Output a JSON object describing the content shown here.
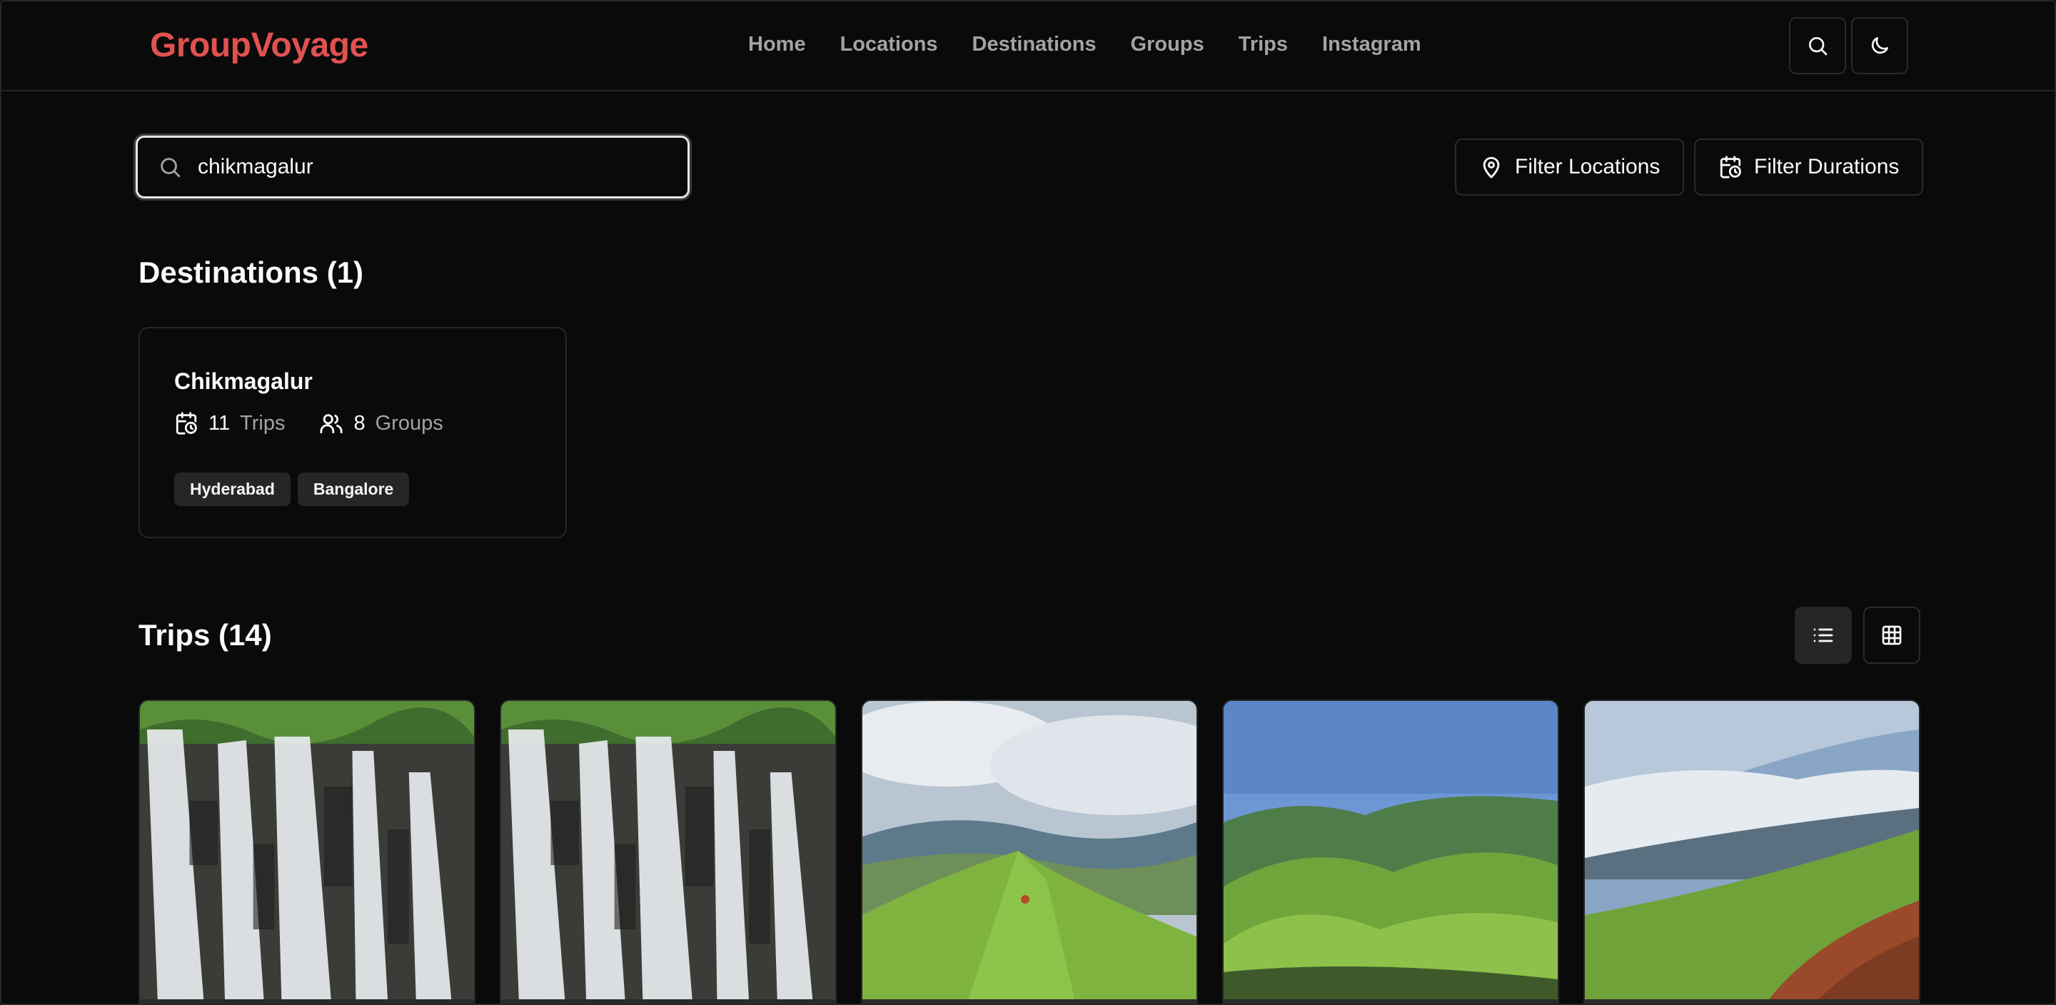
{
  "header": {
    "brand": "GroupVoyage",
    "nav": [
      "Home",
      "Locations",
      "Destinations",
      "Groups",
      "Trips",
      "Instagram"
    ]
  },
  "search": {
    "value": "chikmagalur"
  },
  "filters": {
    "locations": "Filter Locations",
    "durations": "Filter Durations"
  },
  "destinations": {
    "title": "Destinations (1)",
    "items": [
      {
        "name": "Chikmagalur",
        "trips_count": "11",
        "trips_label": "Trips",
        "groups_count": "8",
        "groups_label": "Groups",
        "tags": [
          "Hyderabad",
          "Bangalore"
        ]
      }
    ]
  },
  "trips": {
    "title": "Trips (14)",
    "cards": [
      {
        "image": "waterfall"
      },
      {
        "image": "waterfall"
      },
      {
        "image": "green-ridge-with-hiker"
      },
      {
        "image": "rolling-green-hills"
      },
      {
        "image": "cloudy-hillside-slope"
      }
    ]
  },
  "icons": {
    "search": "search-icon",
    "theme": "moon-icon",
    "pin": "map-pin-icon",
    "calendar": "calendar-clock-icon",
    "users": "users-icon",
    "list": "list-icon",
    "grid": "grid-icon"
  },
  "colors": {
    "brand": "#e0524f",
    "background": "#0a0a0a",
    "border": "#262626",
    "muted": "#a3a3a3"
  }
}
